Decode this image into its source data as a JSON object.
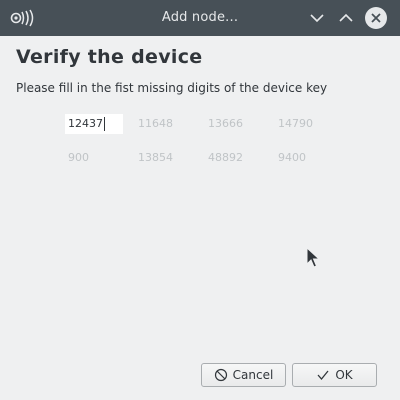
{
  "window": {
    "title": "Add node..."
  },
  "content": {
    "heading": "Verify the device",
    "instruction": "Please fill in the fist missing digits of the device key"
  },
  "key_digits": {
    "input_value": "12437",
    "row1": [
      "11648",
      "13666",
      "14790"
    ],
    "row2": [
      "900",
      "13854",
      "48892",
      "9400"
    ]
  },
  "buttons": {
    "cancel_label": "Cancel",
    "ok_label": "OK"
  },
  "colors": {
    "titlebar": "#475057",
    "background": "#eff0f1",
    "text": "#31363b",
    "muted_digits": "#c0c4c7"
  }
}
